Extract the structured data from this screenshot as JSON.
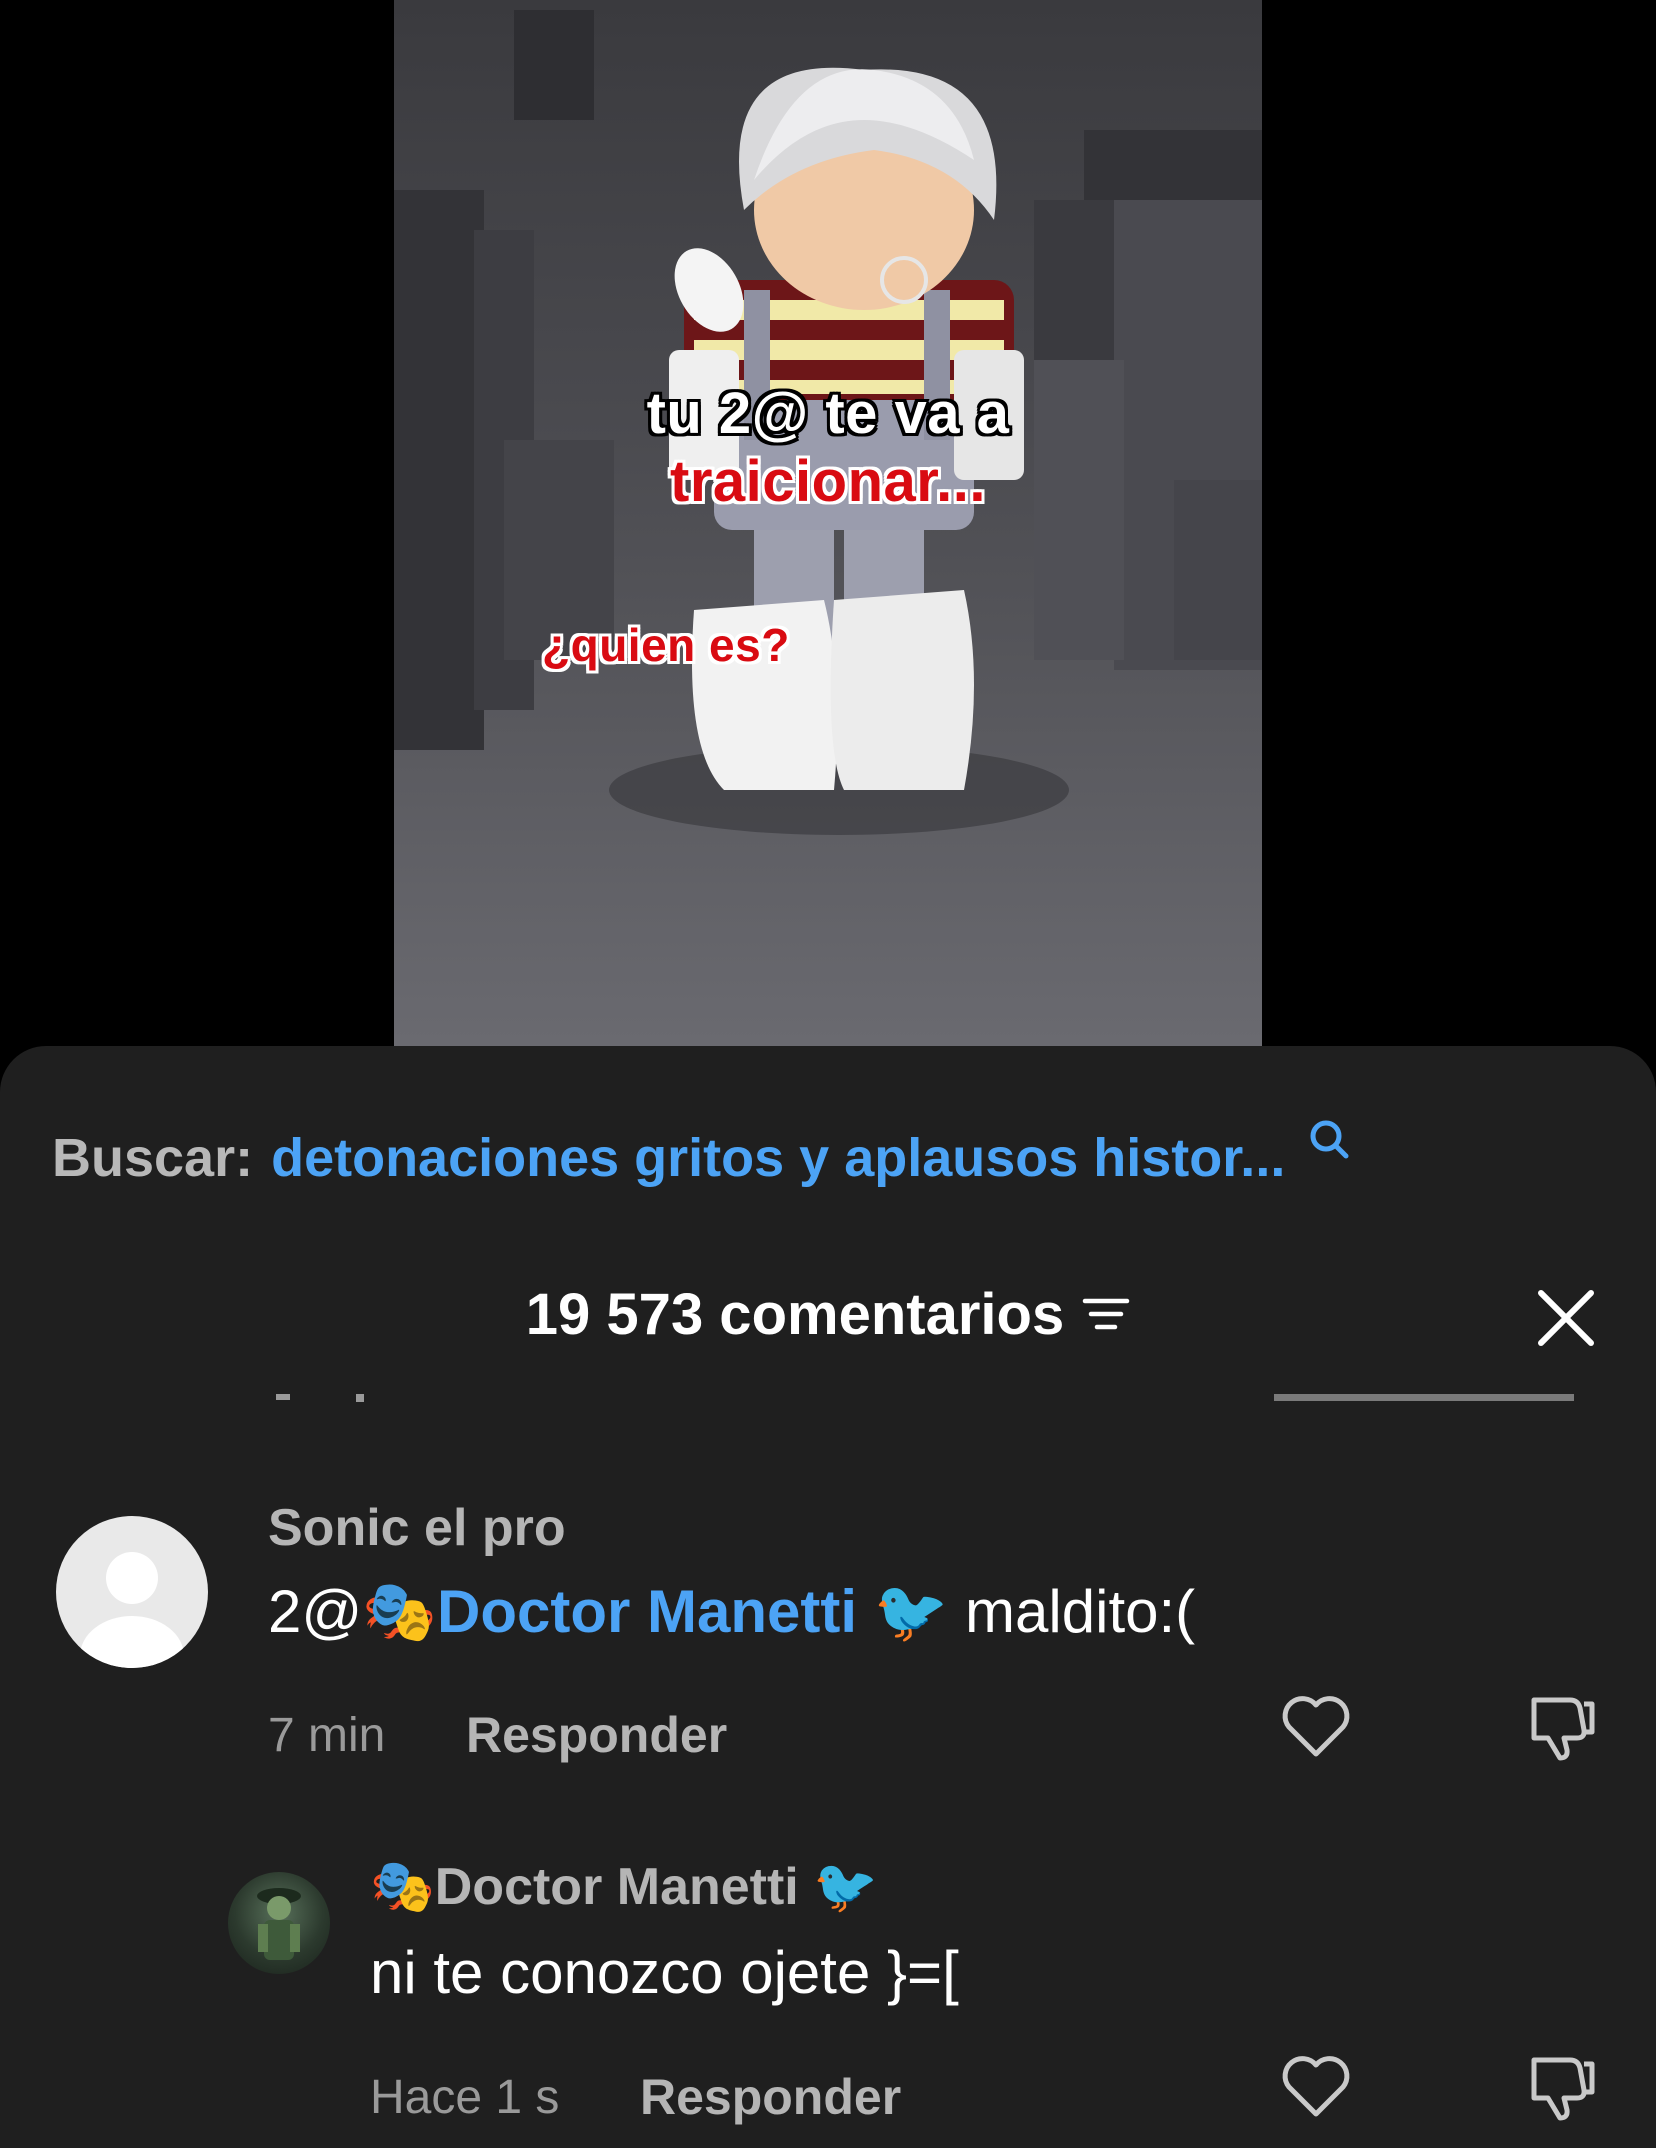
{
  "video": {
    "caption_line1": "tu 2@ te va a",
    "caption_line2": "traicionar...",
    "caption_small": "¿quien es?"
  },
  "search": {
    "prefix": "Buscar:",
    "query": "detonaciones gritos y aplausos histor...",
    "icon": "search-icon",
    "accent": "#4ca3f5"
  },
  "comments_header": {
    "count_label": "19 573 comentarios",
    "sort_icon": "sort-icon",
    "close_icon": "close-icon"
  },
  "comments": [
    {
      "user": "Sonic el pro",
      "text_prefix": "2@",
      "mention_emoji": "🎭",
      "mention": "Doctor Manetti",
      "mention_suffix": "🐦",
      "text_suffix": " maldito:(",
      "time": "7 min",
      "reply_label": "Responder",
      "avatar": "default-avatar"
    },
    {
      "user_emoji": "🎭",
      "user": "Doctor Manetti",
      "user_suffix": "🐦",
      "text": "ni te conozco ojete }=[",
      "time": "Hace 1 s",
      "reply_label": "Responder",
      "avatar": "photo-avatar"
    }
  ],
  "colors": {
    "sheet_bg": "#1f1f1f",
    "link_blue": "#4ca3f5",
    "caption_red": "#d90b12"
  }
}
